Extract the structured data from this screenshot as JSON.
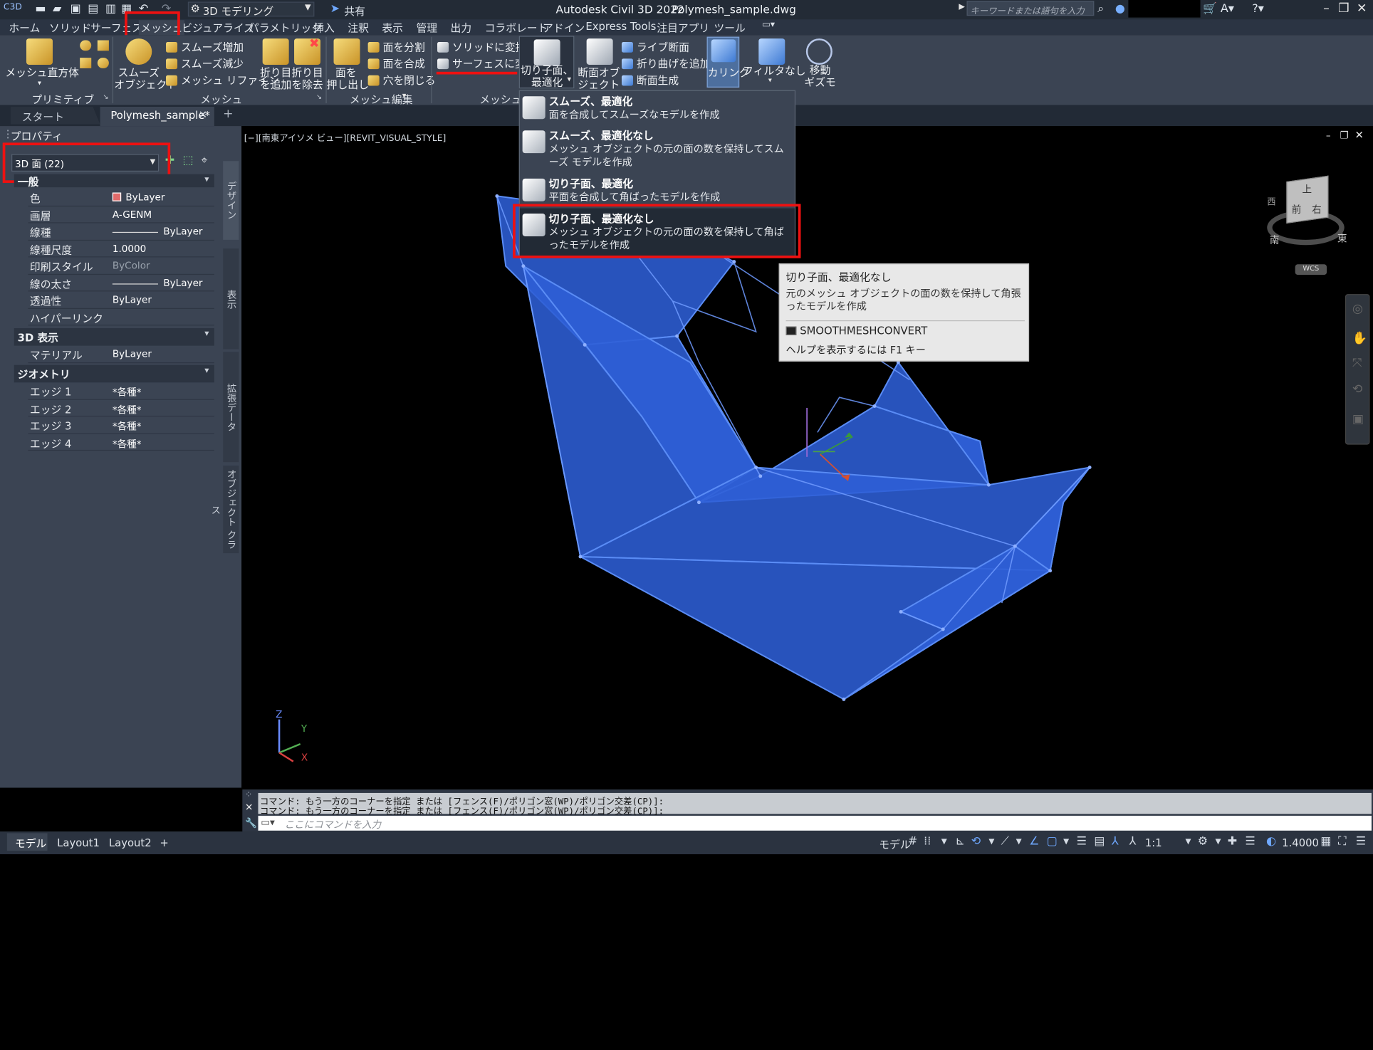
{
  "title": {
    "app_logo": "C3D",
    "workspace": "3D モデリング",
    "share": "共有",
    "caption": "Autodesk Civil 3D 2022",
    "filename": "Polymesh_sample.dwg",
    "search_placeholder": "キーワードまたは語句を入力"
  },
  "ribbon_tabs": [
    "ホーム",
    "ソリッド",
    "サーフェス",
    "メッシュ",
    "ビジュアライズ",
    "パラメトリック",
    "挿入",
    "注釈",
    "表示",
    "管理",
    "出力",
    "コラボレート",
    "アドイン",
    "Express Tools",
    "注目アプリ",
    "ツール"
  ],
  "ribbon": {
    "primitive": {
      "big": "メッシュ直方体",
      "panel": "プリミティブ"
    },
    "mesh": {
      "smooth_obj": [
        "スムーズ",
        "オブジェクト"
      ],
      "items": [
        "スムーズ増加",
        "スムーズ減少",
        "メッシュ リファイン"
      ],
      "crease_add": [
        "折り目",
        "を追加"
      ],
      "crease_remove": [
        "折り目",
        "を除去"
      ],
      "panel": "メッシュ"
    },
    "mesh_edit": {
      "extrude": [
        "面を",
        "押し出し"
      ],
      "items": [
        "面を分割",
        "面を合成",
        "穴を閉じる"
      ],
      "panel": "メッシュ編集"
    },
    "convert": {
      "items": [
        "ソリッドに変換",
        "サーフェスに変換"
      ],
      "big": [
        "切り子面、",
        "最適化"
      ],
      "panel": "メッシュ変"
    },
    "section": {
      "big": [
        "断面オブ",
        "ジェクト"
      ],
      "items": [
        "ライブ断面",
        "折り曲げを追加",
        "断面生成"
      ]
    },
    "culling": "カリング",
    "filter": "フィルタなし",
    "gizmo": [
      "移動",
      "ギズモ"
    ]
  },
  "file_tabs": [
    "スタート",
    "Polymesh_sample*"
  ],
  "palette": {
    "title": "プロパティ",
    "selector": "3D 面 (22)",
    "general_rows": [
      {
        "k": "色",
        "v": "ByLayer"
      },
      {
        "k": "画層",
        "v": "A-GENM"
      },
      {
        "k": "線種",
        "v": "ByLayer"
      },
      {
        "k": "線種尺度",
        "v": "1.0000"
      },
      {
        "k": "印刷スタイル",
        "v": "ByColor"
      },
      {
        "k": "線の太さ",
        "v": "ByLayer"
      },
      {
        "k": "透過性",
        "v": "ByLayer"
      },
      {
        "k": "ハイパーリンク",
        "v": ""
      }
    ],
    "section_3d": "3D 表示",
    "row_material": {
      "k": "マテリアル",
      "v": "ByLayer"
    },
    "section_geo": "ジオメトリ",
    "geo_rows": [
      {
        "k": "エッジ 1",
        "v": "*各種*"
      },
      {
        "k": "エッジ 2",
        "v": "*各種*"
      },
      {
        "k": "エッジ 3",
        "v": "*各種*"
      },
      {
        "k": "エッジ 4",
        "v": "*各種*"
      }
    ],
    "side_tabs": [
      "デザイン",
      "表示",
      "拡張データ",
      "オブジェクト クラス"
    ]
  },
  "viewport": {
    "label": "[−][南東アイソメ ビュー][REVIT_VISUAL_STYLE]",
    "viewcube": {
      "top": "上",
      "front": "前",
      "right": "右",
      "s": "南",
      "e": "東",
      "w": "西"
    },
    "wcs": "WCS",
    "ucs": {
      "x": "X",
      "y": "Y",
      "z": "Z"
    }
  },
  "dropdown": [
    {
      "t": "スムーズ、最適化",
      "d": "面を合成してスムーズなモデルを作成"
    },
    {
      "t": "スムーズ、最適化なし",
      "d": "メッシュ オブジェクトの元の面の数を保持してスムーズ モデルを作成"
    },
    {
      "t": "切り子面、最適化",
      "d": "平面を合成して角ばったモデルを作成"
    },
    {
      "t": "切り子面、最適化なし",
      "d": "メッシュ オブジェクトの元の面の数を保持して角ばったモデルを作成"
    }
  ],
  "tooltip": {
    "title": "切り子面、最適化なし",
    "desc": "元のメッシュ オブジェクトの面の数を保持して角張ったモデルを作成",
    "command": "SMOOTHMESHCONVERT",
    "help": "ヘルプを表示するには F1 キー"
  },
  "command": {
    "lines": [
      "コマンド: もう一方のコーナーを指定 または [フェンス(F)/ポリゴン窓(WP)/ポリゴン交差(CP)]:",
      "コマンド: もう一方のコーナーを指定 または [フェンス(F)/ポリゴン窓(WP)/ポリゴン交差(CP)]:"
    ],
    "placeholder": "ここにコマンドを入力"
  },
  "layout_tabs": [
    "モデル",
    "Layout1",
    "Layout2"
  ],
  "status": {
    "model": "モデル",
    "scale": "1:1",
    "value": "1.4000"
  },
  "colors": {
    "accent_red": "#e11111",
    "mesh_blue": "#2d5fd6",
    "mesh_edge": "#5a8cf5"
  }
}
